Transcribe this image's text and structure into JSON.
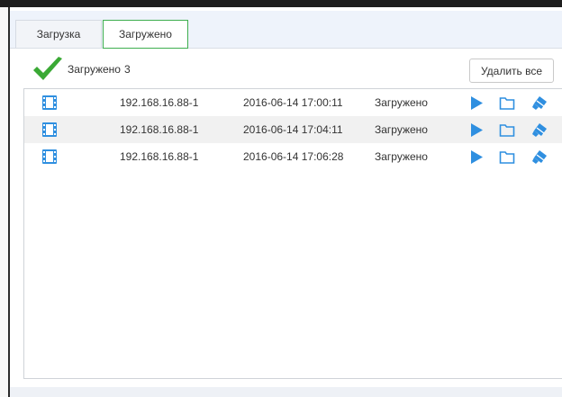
{
  "tabs": [
    {
      "label": "Загрузка",
      "active": false
    },
    {
      "label": "Загружено",
      "active": true
    }
  ],
  "summary": {
    "label": "Загружено",
    "count": "3"
  },
  "actions": {
    "delete_all": "Удалить все"
  },
  "colors": {
    "accent": "#3eae4f",
    "icon_blue": "#2f8fe0",
    "check_green": "#3aa935"
  },
  "downloads": [
    {
      "ip": "192.168.16.88-1",
      "time": "2016-06-14 17:00:11",
      "status": "Загружено"
    },
    {
      "ip": "192.168.16.88-1",
      "time": "2016-06-14 17:04:11",
      "status": "Загружено"
    },
    {
      "ip": "192.168.16.88-1",
      "time": "2016-06-14 17:06:28",
      "status": "Загружено"
    }
  ],
  "row_icons": [
    "film-icon",
    "play-icon",
    "folder-icon",
    "clear-icon"
  ]
}
